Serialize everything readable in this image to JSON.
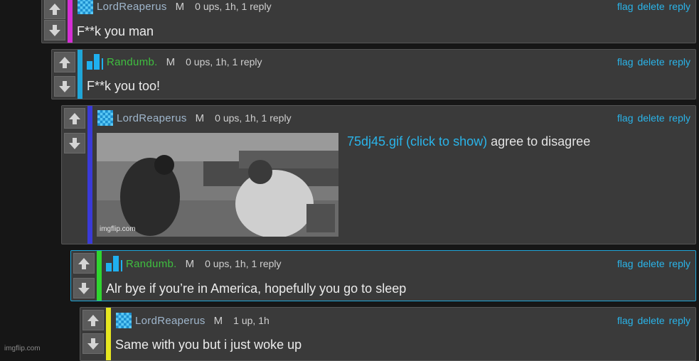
{
  "comments": [
    {
      "username": "LordReaperus",
      "gender": "M",
      "meta": "0 ups, 1h, 1 reply",
      "text": "F**k you man",
      "bar_color": "#d52fd5",
      "avatar": "checker-avatar"
    },
    {
      "username": "Randumb.",
      "gender": "M",
      "meta": "0 ups, 1h, 1 reply",
      "text": "F**k you too!",
      "bar_color": "#1fa6d8",
      "avatar": "bars-avatar"
    },
    {
      "username": "LordReaperus",
      "gender": "M",
      "meta": "0 ups, 1h, 1 reply",
      "gif_link": "75dj45.gif (click to show)",
      "gif_caption": "agree to disagree",
      "gif_watermark": "imgflip.com",
      "bar_color": "#3a3ad8",
      "avatar": "checker-avatar"
    },
    {
      "username": "Randumb.",
      "gender": "M",
      "meta": "0 ups, 1h, 1 reply",
      "text": "Alr bye if you’re in America, hopefully you go to sleep",
      "bar_color": "#2fd52f",
      "avatar": "bars-avatar"
    },
    {
      "username": "LordReaperus",
      "gender": "M",
      "meta": "1 up, 1h",
      "text": "Same with you but i just woke up",
      "bar_color": "#e6e620",
      "avatar": "checker-avatar"
    }
  ],
  "actions": {
    "flag": "flag",
    "delete": "delete",
    "reply": "reply"
  },
  "colors": {
    "link": "#2ab4e9",
    "panel": "#3a3a3a",
    "background": "#161616",
    "highlight_border": "#1fa6d8"
  },
  "icons": {
    "upvote": "arrow-up-icon",
    "downvote": "arrow-down-icon"
  },
  "footer_watermark": "imgflip.com"
}
